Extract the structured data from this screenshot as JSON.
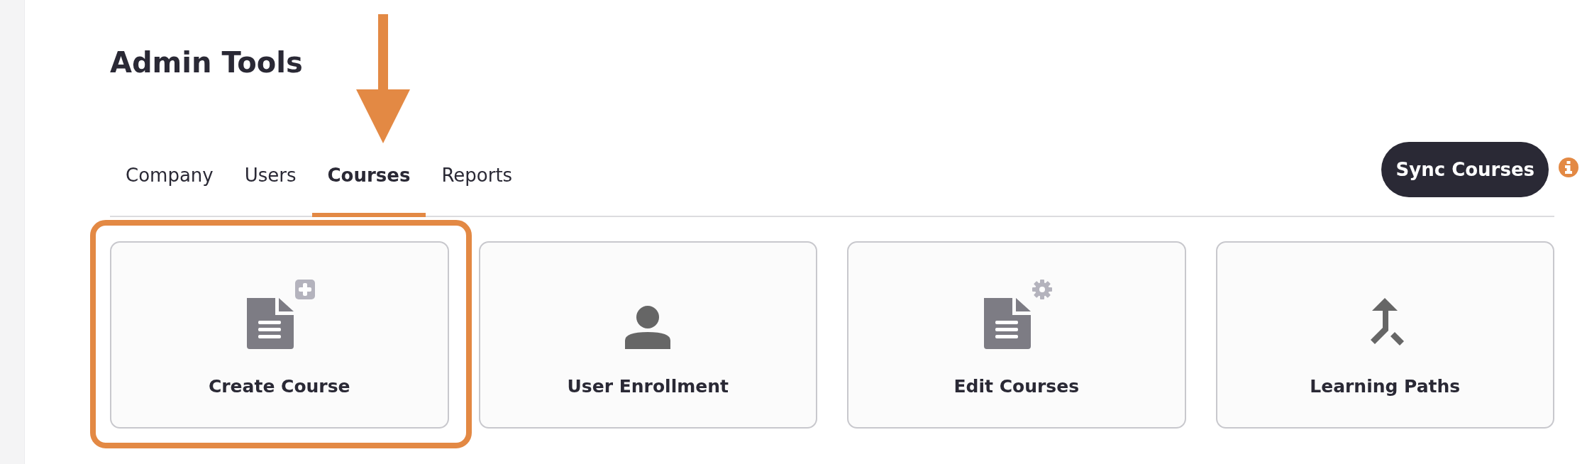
{
  "title": "Admin Tools",
  "tabs": [
    {
      "label": "Company",
      "selected": false
    },
    {
      "label": "Users",
      "selected": false
    },
    {
      "label": "Courses",
      "selected": true
    },
    {
      "label": "Reports",
      "selected": false
    }
  ],
  "sync_button": {
    "label": "Sync Courses"
  },
  "cards": [
    {
      "label": "Create Course",
      "kind": "create",
      "highlighted": true
    },
    {
      "label": "User Enrollment",
      "kind": "enroll",
      "highlighted": false
    },
    {
      "label": "Edit Courses",
      "kind": "edit",
      "highlighted": false
    },
    {
      "label": "Learning Paths",
      "kind": "paths",
      "highlighted": false
    }
  ]
}
